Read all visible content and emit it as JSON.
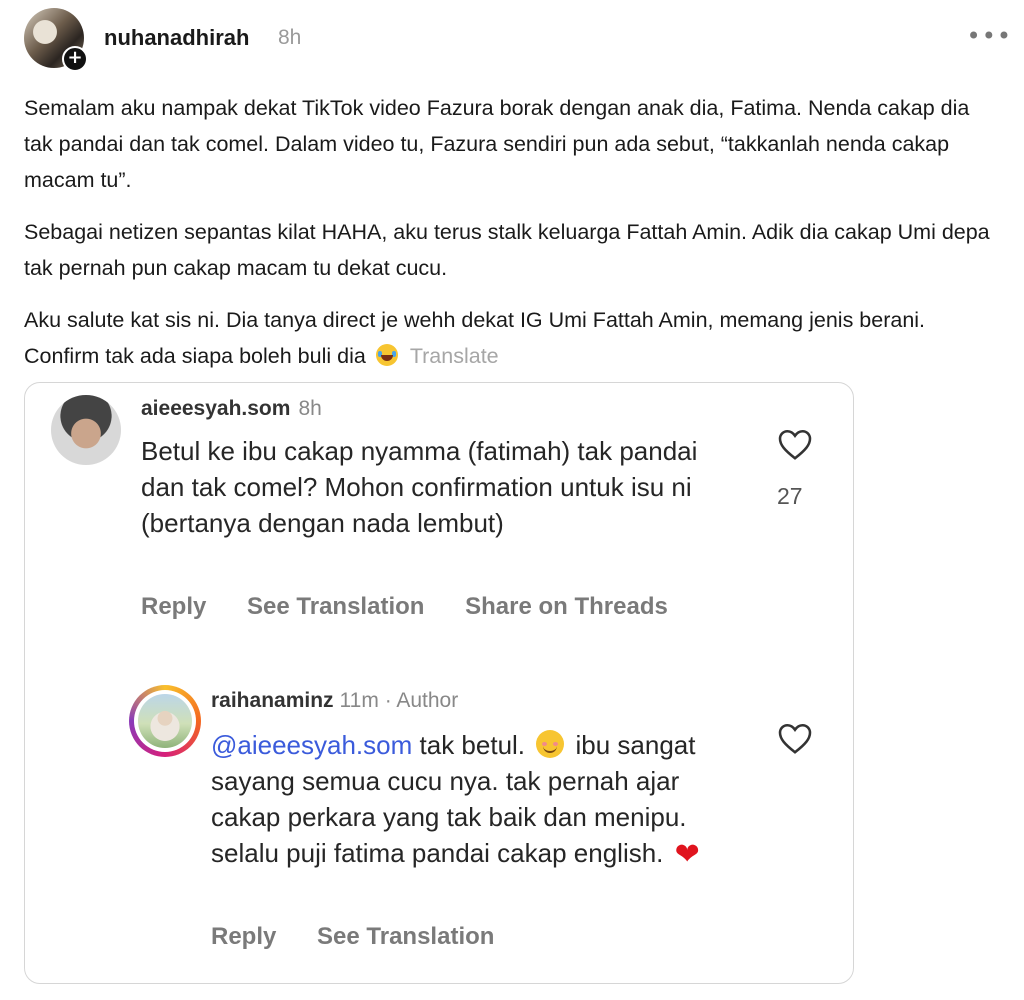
{
  "post": {
    "username": "nuhanadhirah",
    "time": "8h",
    "more_icon": "more-horizontal-icon",
    "paragraphs": [
      "Semalam aku nampak dekat TikTok video Fazura borak dengan anak dia, Fatima. Nenda cakap dia tak pandai dan tak comel. Dalam video tu, Fazura sendiri pun ada sebut, “takkanlah nenda cakap macam tu”.",
      "Sebagai netizen sepantas kilat HAHA, aku terus stalk keluarga Fattah Amin. Adik dia cakap Umi depa tak pernah pun cakap macam tu dekat cucu.",
      "Aku salute kat sis ni. Dia tanya direct je wehh dekat IG Umi Fattah Amin, memang jenis berani. Confirm tak ada siapa boleh buli dia"
    ],
    "emoji": "laughing-with-tears-emoji",
    "translate_label": "Translate"
  },
  "embed": {
    "comment1": {
      "username": "aieeesyah.som",
      "time": "8h",
      "text": "Betul ke ibu cakap nyamma (fatimah) tak pandai dan tak comel? Mohon confirmation untuk isu ni (bertanya dengan nada lembut)",
      "likes": "27",
      "actions": {
        "reply": "Reply",
        "see_translation": "See Translation",
        "share": "Share on Threads"
      }
    },
    "comment2": {
      "username": "raihanaminz",
      "time": "11m",
      "badge": "· Author",
      "mention": "@aieeesyah.som",
      "text_a": "tak betul.",
      "text_b": "ibu sangat sayang semua cucu nya. tak pernah ajar cakap perkara yang tak baik dan menipu. selalu puji fatima pandai cakap english.",
      "actions": {
        "reply": "Reply",
        "see_translation": "See Translation"
      }
    }
  }
}
